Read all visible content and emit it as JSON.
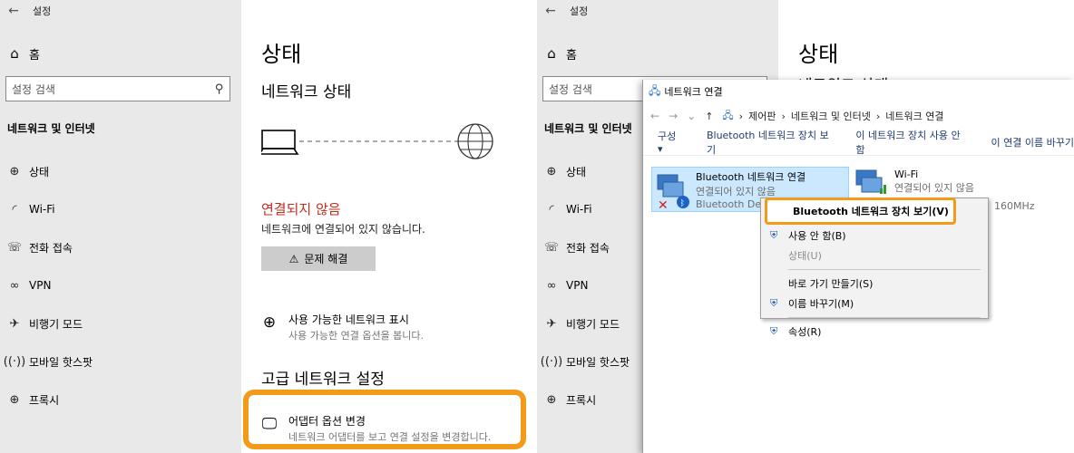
{
  "left": {
    "titlebar": {
      "back": "←",
      "title": "설정"
    },
    "home": {
      "icon": "home-icon",
      "label": "홈"
    },
    "search": {
      "placeholder": "설정 검색"
    },
    "section": "네트워크 및 인터넷",
    "nav": [
      {
        "icon": "globe-icon",
        "label": "상태"
      },
      {
        "icon": "wifi-icon",
        "label": "Wi-Fi"
      },
      {
        "icon": "dialup-icon",
        "label": "전화 접속"
      },
      {
        "icon": "vpn-icon",
        "label": "VPN"
      },
      {
        "icon": "airplane-icon",
        "label": "비행기 모드"
      },
      {
        "icon": "hotspot-icon",
        "label": "모바일 핫스팟"
      },
      {
        "icon": "proxy-icon",
        "label": "프록시"
      }
    ],
    "main": {
      "title": "상태",
      "network_status": "네트워크 상태",
      "not_connected": "연결되지 않음",
      "not_connected_sub": "네트워크에 연결되어 있지 않습니다.",
      "troubleshoot": "문제 해결",
      "show_networks_title": "사용 가능한 네트워크 표시",
      "show_networks_sub": "사용 가능한 연결 옵션을 봅니다.",
      "advanced": "고급 네트워크 설정",
      "adapter_title": "어댑터 옵션 변경",
      "adapter_sub": "네트워크 어댑터를 보고 연결 설정을 변경합니다."
    }
  },
  "right": {
    "titlebar": {
      "back": "←",
      "title": "설정"
    },
    "home": {
      "label": "홈"
    },
    "search": {
      "placeholder": "설정 검색"
    },
    "section": "네트워크 및 인터넷",
    "nav": [
      {
        "label": "상태"
      },
      {
        "label": "Wi-Fi"
      },
      {
        "label": "전화 접속"
      },
      {
        "label": "VPN"
      },
      {
        "label": "비행기 모드"
      },
      {
        "label": "모바일 핫스팟"
      },
      {
        "label": "프록시"
      }
    ],
    "main": {
      "title": "상태",
      "network_status": "네트워크 상태"
    },
    "window": {
      "title": "네트워크 연결",
      "breadcrumb": [
        "제어판",
        "네트워크 및 인터넷",
        "네트워크 연결"
      ],
      "commands": [
        "구성 ▾",
        "Bluetooth 네트워크 장치 보기",
        "이 네트워크 장치 사용 안 함",
        "이 연결 이름 바꾸기"
      ],
      "adapters": [
        {
          "name": "Bluetooth 네트워크 연결",
          "status": "연결되어 있지 않음",
          "device": "Bluetooth Devic"
        },
        {
          "name": "Wi-Fi",
          "status": "연결되어 있지 않음",
          "device": "160MHz"
        }
      ],
      "context_menu": {
        "highlighted": "Bluetooth 네트워크 장치 보기(V)",
        "items": [
          "사용 안 함(B)",
          "상태(U)",
          "바로 가기 만들기(S)",
          "이름 바꾸기(M)",
          "속성(R)"
        ]
      }
    }
  },
  "colors": {
    "accent_highlight": "#f39a19",
    "error_red": "#c42b1c",
    "sidebar_bg": "#e9e9e9"
  }
}
